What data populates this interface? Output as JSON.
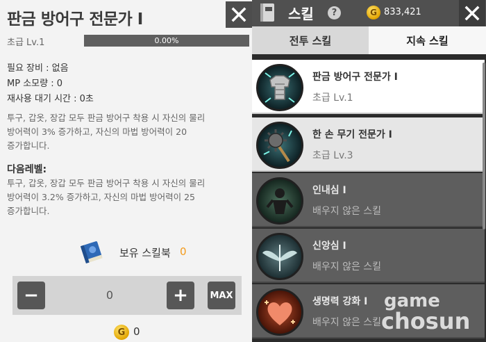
{
  "left_panel": {
    "title": "판금 방어구 전문가 I",
    "level": "초급 Lv.1",
    "progress": {
      "value": 0.0,
      "label": "0.00%"
    },
    "required_equipment": "필요 장비 : 없음",
    "mp_cost": "MP 소모량 : 0",
    "cooldown": "재사용 대기 시간 : 0초",
    "description_lines": [
      "투구, 갑옷, 장갑 모두 판금 방어구 착용 시 자신의 물리",
      "방어력이 3% 증가하고, 자신의 마법 방어력이 20",
      "증가합니다."
    ],
    "next_level_label": "다음레벨:",
    "next_level_lines": [
      "투구, 갑옷, 장갑 모두 판금 방어구 착용 시 자신의 물리",
      "방어력이 3.2% 증가하고, 자신의 마법 방어력이 25",
      "증가합니다."
    ],
    "skillbook_label": "보유 스킬북",
    "skillbook_count": "0",
    "quantity": "0",
    "minus_label": "−",
    "plus_label": "+",
    "max_label": "MAX",
    "coin_symbol": "G",
    "cost": "0"
  },
  "right_panel": {
    "title": "스킬",
    "help_symbol": "?",
    "coin_symbol": "G",
    "gold": "833,421",
    "tabs": [
      "전투 스킬",
      "지속 스킬"
    ],
    "active_tab": "지속 스킬",
    "skills": [
      {
        "name": "판금 방어구 전문가 I",
        "status": "초급 Lv.1",
        "learned": true,
        "icon": "armor-icon"
      },
      {
        "name": "한 손 무기 전문가 I",
        "status": "초급 Lv.3",
        "learned": true,
        "icon": "mace-icon"
      },
      {
        "name": "인내심 I",
        "status": "배우지 않은 스킬",
        "learned": false,
        "icon": "figure-icon"
      },
      {
        "name": "신앙심 I",
        "status": "배우지 않은 스킬",
        "learned": false,
        "icon": "wings-icon"
      },
      {
        "name": "생명력 강화 I",
        "status": "배우지 않은 스킬",
        "learned": false,
        "icon": "heart-icon"
      }
    ]
  },
  "watermark": {
    "line1": "game",
    "line2": "chosun"
  },
  "colors": {
    "progress_fill": "#9ecb3a",
    "accent_orange": "#f39a1a",
    "header_dark": "#505050"
  }
}
